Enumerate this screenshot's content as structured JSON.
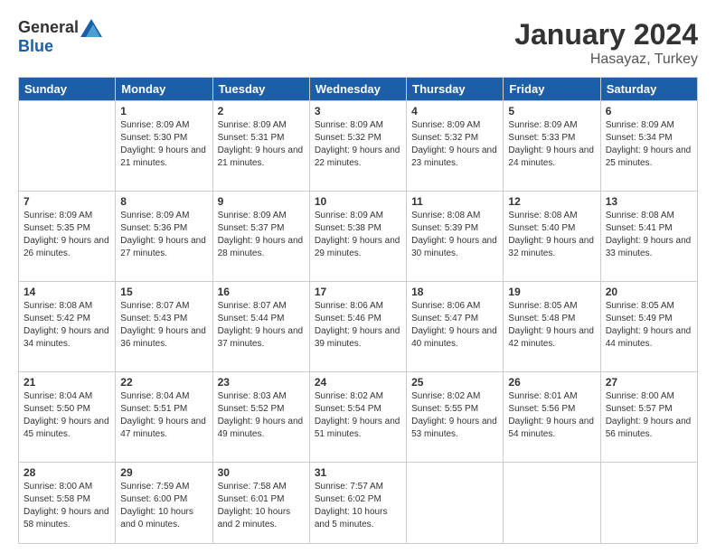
{
  "header": {
    "logo_general": "General",
    "logo_blue": "Blue",
    "month": "January 2024",
    "location": "Hasayaz, Turkey"
  },
  "weekdays": [
    "Sunday",
    "Monday",
    "Tuesday",
    "Wednesday",
    "Thursday",
    "Friday",
    "Saturday"
  ],
  "weeks": [
    [
      {
        "day": "",
        "sunrise": "",
        "sunset": "",
        "daylight": ""
      },
      {
        "day": "1",
        "sunrise": "Sunrise: 8:09 AM",
        "sunset": "Sunset: 5:30 PM",
        "daylight": "Daylight: 9 hours and 21 minutes."
      },
      {
        "day": "2",
        "sunrise": "Sunrise: 8:09 AM",
        "sunset": "Sunset: 5:31 PM",
        "daylight": "Daylight: 9 hours and 21 minutes."
      },
      {
        "day": "3",
        "sunrise": "Sunrise: 8:09 AM",
        "sunset": "Sunset: 5:32 PM",
        "daylight": "Daylight: 9 hours and 22 minutes."
      },
      {
        "day": "4",
        "sunrise": "Sunrise: 8:09 AM",
        "sunset": "Sunset: 5:32 PM",
        "daylight": "Daylight: 9 hours and 23 minutes."
      },
      {
        "day": "5",
        "sunrise": "Sunrise: 8:09 AM",
        "sunset": "Sunset: 5:33 PM",
        "daylight": "Daylight: 9 hours and 24 minutes."
      },
      {
        "day": "6",
        "sunrise": "Sunrise: 8:09 AM",
        "sunset": "Sunset: 5:34 PM",
        "daylight": "Daylight: 9 hours and 25 minutes."
      }
    ],
    [
      {
        "day": "7",
        "sunrise": "Sunrise: 8:09 AM",
        "sunset": "Sunset: 5:35 PM",
        "daylight": "Daylight: 9 hours and 26 minutes."
      },
      {
        "day": "8",
        "sunrise": "Sunrise: 8:09 AM",
        "sunset": "Sunset: 5:36 PM",
        "daylight": "Daylight: 9 hours and 27 minutes."
      },
      {
        "day": "9",
        "sunrise": "Sunrise: 8:09 AM",
        "sunset": "Sunset: 5:37 PM",
        "daylight": "Daylight: 9 hours and 28 minutes."
      },
      {
        "day": "10",
        "sunrise": "Sunrise: 8:09 AM",
        "sunset": "Sunset: 5:38 PM",
        "daylight": "Daylight: 9 hours and 29 minutes."
      },
      {
        "day": "11",
        "sunrise": "Sunrise: 8:08 AM",
        "sunset": "Sunset: 5:39 PM",
        "daylight": "Daylight: 9 hours and 30 minutes."
      },
      {
        "day": "12",
        "sunrise": "Sunrise: 8:08 AM",
        "sunset": "Sunset: 5:40 PM",
        "daylight": "Daylight: 9 hours and 32 minutes."
      },
      {
        "day": "13",
        "sunrise": "Sunrise: 8:08 AM",
        "sunset": "Sunset: 5:41 PM",
        "daylight": "Daylight: 9 hours and 33 minutes."
      }
    ],
    [
      {
        "day": "14",
        "sunrise": "Sunrise: 8:08 AM",
        "sunset": "Sunset: 5:42 PM",
        "daylight": "Daylight: 9 hours and 34 minutes."
      },
      {
        "day": "15",
        "sunrise": "Sunrise: 8:07 AM",
        "sunset": "Sunset: 5:43 PM",
        "daylight": "Daylight: 9 hours and 36 minutes."
      },
      {
        "day": "16",
        "sunrise": "Sunrise: 8:07 AM",
        "sunset": "Sunset: 5:44 PM",
        "daylight": "Daylight: 9 hours and 37 minutes."
      },
      {
        "day": "17",
        "sunrise": "Sunrise: 8:06 AM",
        "sunset": "Sunset: 5:46 PM",
        "daylight": "Daylight: 9 hours and 39 minutes."
      },
      {
        "day": "18",
        "sunrise": "Sunrise: 8:06 AM",
        "sunset": "Sunset: 5:47 PM",
        "daylight": "Daylight: 9 hours and 40 minutes."
      },
      {
        "day": "19",
        "sunrise": "Sunrise: 8:05 AM",
        "sunset": "Sunset: 5:48 PM",
        "daylight": "Daylight: 9 hours and 42 minutes."
      },
      {
        "day": "20",
        "sunrise": "Sunrise: 8:05 AM",
        "sunset": "Sunset: 5:49 PM",
        "daylight": "Daylight: 9 hours and 44 minutes."
      }
    ],
    [
      {
        "day": "21",
        "sunrise": "Sunrise: 8:04 AM",
        "sunset": "Sunset: 5:50 PM",
        "daylight": "Daylight: 9 hours and 45 minutes."
      },
      {
        "day": "22",
        "sunrise": "Sunrise: 8:04 AM",
        "sunset": "Sunset: 5:51 PM",
        "daylight": "Daylight: 9 hours and 47 minutes."
      },
      {
        "day": "23",
        "sunrise": "Sunrise: 8:03 AM",
        "sunset": "Sunset: 5:52 PM",
        "daylight": "Daylight: 9 hours and 49 minutes."
      },
      {
        "day": "24",
        "sunrise": "Sunrise: 8:02 AM",
        "sunset": "Sunset: 5:54 PM",
        "daylight": "Daylight: 9 hours and 51 minutes."
      },
      {
        "day": "25",
        "sunrise": "Sunrise: 8:02 AM",
        "sunset": "Sunset: 5:55 PM",
        "daylight": "Daylight: 9 hours and 53 minutes."
      },
      {
        "day": "26",
        "sunrise": "Sunrise: 8:01 AM",
        "sunset": "Sunset: 5:56 PM",
        "daylight": "Daylight: 9 hours and 54 minutes."
      },
      {
        "day": "27",
        "sunrise": "Sunrise: 8:00 AM",
        "sunset": "Sunset: 5:57 PM",
        "daylight": "Daylight: 9 hours and 56 minutes."
      }
    ],
    [
      {
        "day": "28",
        "sunrise": "Sunrise: 8:00 AM",
        "sunset": "Sunset: 5:58 PM",
        "daylight": "Daylight: 9 hours and 58 minutes."
      },
      {
        "day": "29",
        "sunrise": "Sunrise: 7:59 AM",
        "sunset": "Sunset: 6:00 PM",
        "daylight": "Daylight: 10 hours and 0 minutes."
      },
      {
        "day": "30",
        "sunrise": "Sunrise: 7:58 AM",
        "sunset": "Sunset: 6:01 PM",
        "daylight": "Daylight: 10 hours and 2 minutes."
      },
      {
        "day": "31",
        "sunrise": "Sunrise: 7:57 AM",
        "sunset": "Sunset: 6:02 PM",
        "daylight": "Daylight: 10 hours and 5 minutes."
      },
      {
        "day": "",
        "sunrise": "",
        "sunset": "",
        "daylight": ""
      },
      {
        "day": "",
        "sunrise": "",
        "sunset": "",
        "daylight": ""
      },
      {
        "day": "",
        "sunrise": "",
        "sunset": "",
        "daylight": ""
      }
    ]
  ]
}
